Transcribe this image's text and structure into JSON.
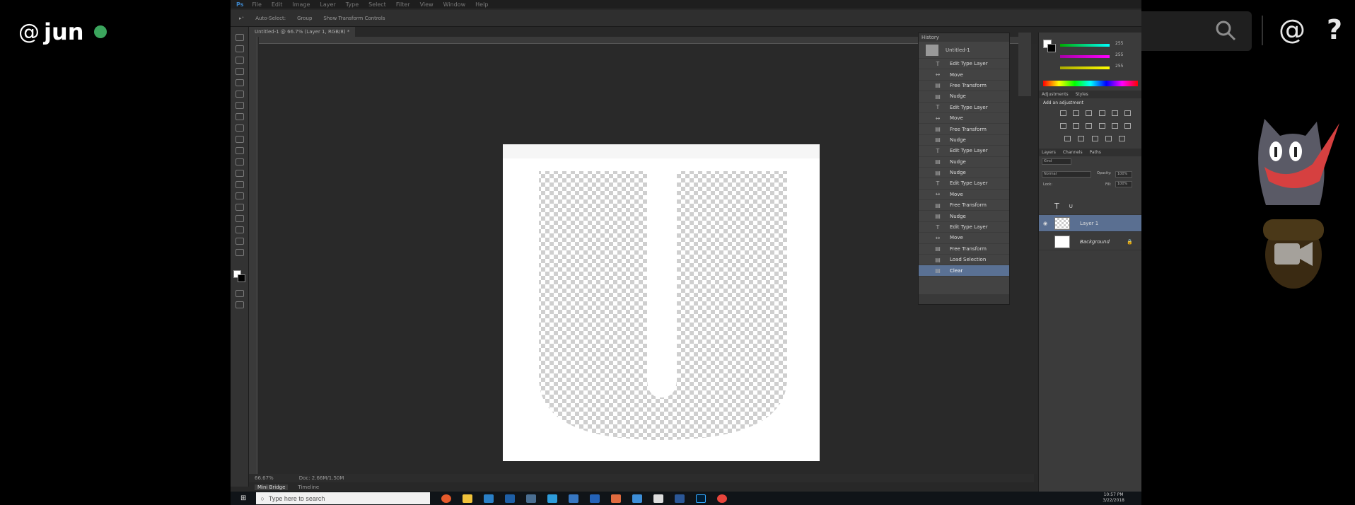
{
  "overlay": {
    "user_at": "@",
    "username": "jun",
    "search_placeholder": "Search",
    "mention_symbol": "@",
    "help_symbol": "?",
    "status_color": "#3ba55d"
  },
  "photoshop": {
    "app_logo": "Ps",
    "menu": [
      "File",
      "Edit",
      "Image",
      "Layer",
      "Type",
      "Select",
      "Filter",
      "View",
      "Window",
      "Help"
    ],
    "options": [
      "Auto-Select:",
      "Group",
      "Show Transform Controls"
    ],
    "document_tab": "Untitled-1 @ 66.7% (Layer 1, RGB/8) *",
    "status": {
      "zoom": "66.67%",
      "doc": "Doc: 2.66M/1.50M"
    },
    "bottom_tabs": [
      "Mini Bridge",
      "Timeline"
    ],
    "history": {
      "title": "History",
      "snapshot": "Untitled-1",
      "items": [
        {
          "icon": "T",
          "label": "Edit Type Layer"
        },
        {
          "icon": "↔",
          "label": "Move"
        },
        {
          "icon": "▤",
          "label": "Free Transform"
        },
        {
          "icon": "▤",
          "label": "Nudge"
        },
        {
          "icon": "T",
          "label": "Edit Type Layer"
        },
        {
          "icon": "↔",
          "label": "Move"
        },
        {
          "icon": "▤",
          "label": "Free Transform"
        },
        {
          "icon": "▤",
          "label": "Nudge"
        },
        {
          "icon": "T",
          "label": "Edit Type Layer"
        },
        {
          "icon": "▤",
          "label": "Nudge"
        },
        {
          "icon": "▤",
          "label": "Nudge"
        },
        {
          "icon": "T",
          "label": "Edit Type Layer"
        },
        {
          "icon": "↔",
          "label": "Move"
        },
        {
          "icon": "▤",
          "label": "Free Transform"
        },
        {
          "icon": "▤",
          "label": "Nudge"
        },
        {
          "icon": "T",
          "label": "Edit Type Layer"
        },
        {
          "icon": "↔",
          "label": "Move"
        },
        {
          "icon": "▤",
          "label": "Free Transform"
        },
        {
          "icon": "▤",
          "label": "Load Selection"
        },
        {
          "icon": "▤",
          "label": "Clear"
        }
      ]
    },
    "panels": {
      "color_values": [
        "255",
        "255",
        "255"
      ],
      "adjustments_tabs": [
        "Adjustments",
        "Styles"
      ],
      "adjustments_title": "Add an adjustment",
      "layers_tabs": [
        "Layers",
        "Channels",
        "Paths"
      ],
      "filter_kind": "Kind",
      "blend_mode": "Normal",
      "opacity_label": "Opacity:",
      "opacity_value": "100%",
      "lock_label": "Lock:",
      "fill_label": "Fill:",
      "fill_value": "100%",
      "layers": [
        {
          "name": "U",
          "type": "text"
        },
        {
          "name": "Layer 1",
          "type": "pixel",
          "selected": true
        },
        {
          "name": "Background",
          "type": "background"
        }
      ]
    }
  },
  "taskbar": {
    "search_placeholder": "Type here to search",
    "time": "10:57 PM",
    "date": "3/22/2018"
  }
}
